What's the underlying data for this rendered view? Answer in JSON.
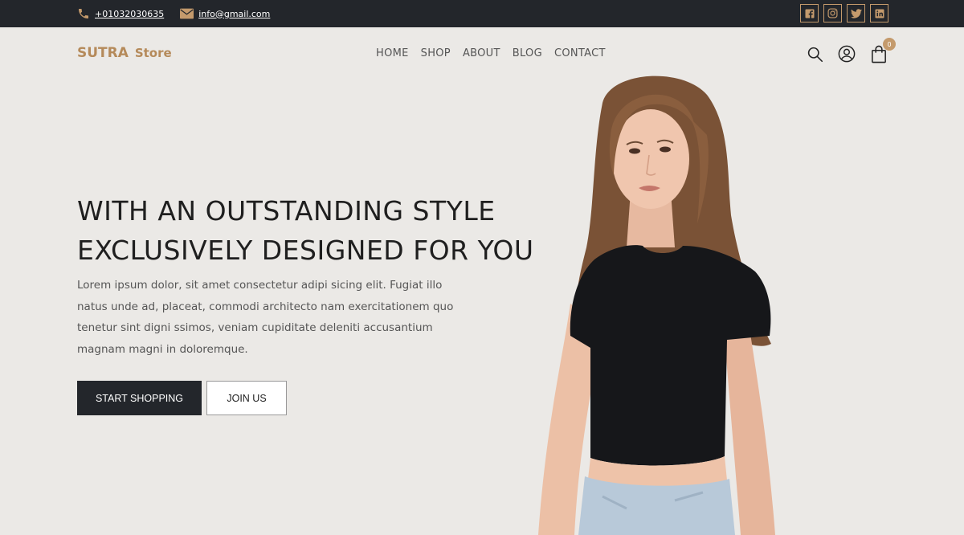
{
  "topbar": {
    "phone": "+01032030635",
    "email": "info@gmail.com",
    "socials": [
      "facebook-icon",
      "instagram-icon",
      "twitter-icon",
      "linkedin-icon"
    ]
  },
  "header": {
    "logo_main": "SUTRA",
    "logo_sub": "Store",
    "nav": [
      "HOME",
      "SHOP",
      "ABOUT",
      "BLOG",
      "CONTACT"
    ],
    "cart_count": "0"
  },
  "hero": {
    "title_line1": "WITH AN OUTSTANDING STYLE",
    "title_line2": "EXCLUSIVELY DESIGNED FOR YOU",
    "description": "Lorem ipsum dolor, sit amet consectetur adipi sicing elit. Fugiat illo natus unde ad, placeat, commodi architecto nam exercitationem quo tenetur sint digni ssimos, veniam cupiditate deleniti accusantium magnam magni in doloremque.",
    "primary_button": "START SHOPPING",
    "secondary_button": "JOIN US"
  },
  "colors": {
    "accent": "#c49a6c",
    "dark": "#23262b",
    "background": "#ebe9e6"
  }
}
